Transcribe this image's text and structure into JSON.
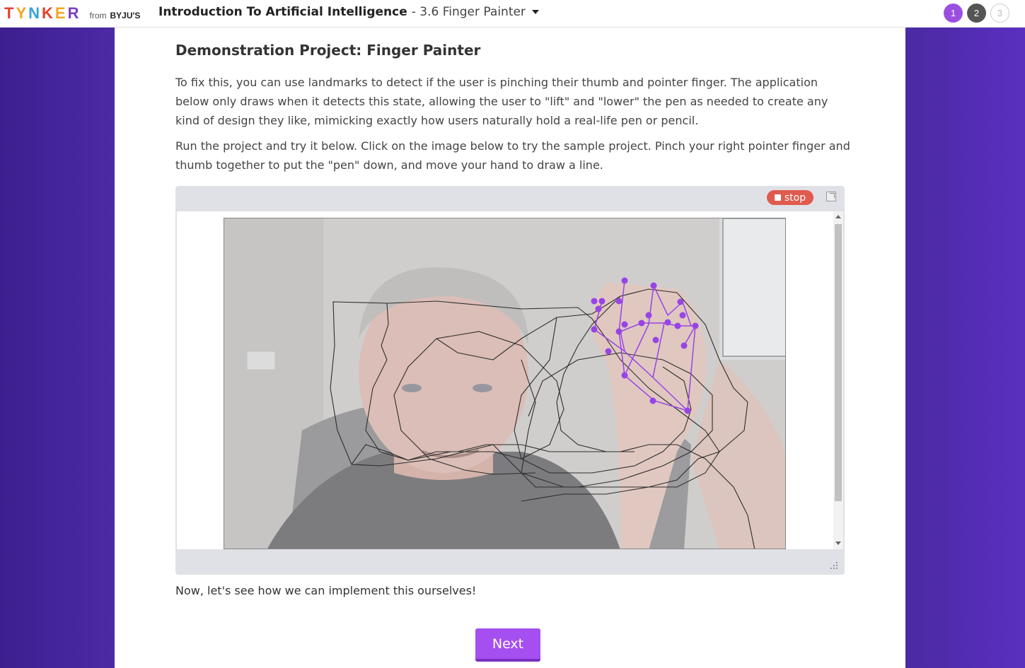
{
  "header": {
    "logo": {
      "word": "TYNKER",
      "from": "from",
      "brand": "BYJU'S"
    },
    "course_title": "Introduction To Artificial Intelligence",
    "lesson": "- 3.6 Finger Painter",
    "steps": [
      "1",
      "2",
      "3"
    ]
  },
  "content": {
    "heading": "Demonstration Project: Finger Painter",
    "paragraph1": "To fix this, you can use landmarks to detect if the user is pinching their thumb and pointer finger. The application below only draws when it detects this state, allowing the user to \"lift\" and \"lower\" the pen as needed to create any kind of design they like, mimicking exactly how users naturally hold a real-life pen or pencil.",
    "paragraph2": "Run the project and try it below. Click on the image below to try the sample project. Pinch your right pointer finger and thumb together to put the \"pen\" down, and move your hand to draw a line.",
    "runner": {
      "stop_label": "stop"
    },
    "paragraph3": "Now, let's see how we can implement this ourselves!",
    "next_label": "Next"
  },
  "colors": {
    "accent": "#a64ff0",
    "stop": "#e05a4e",
    "landmarks": "#8a2be2"
  },
  "icons": [
    "stop-icon",
    "popout-icon",
    "caret-down-icon",
    "resize-handle-icon"
  ]
}
